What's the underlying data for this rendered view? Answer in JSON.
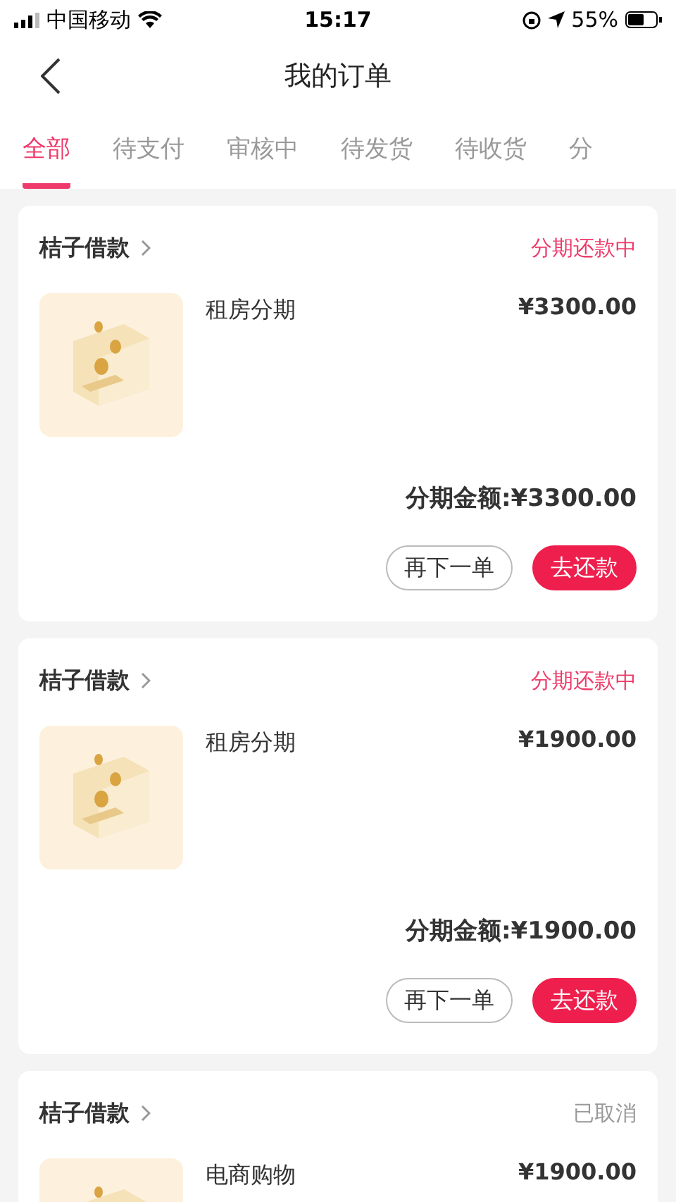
{
  "status_bar": {
    "carrier": "中国移动",
    "time": "15:17",
    "battery": "55%"
  },
  "nav": {
    "title": "我的订单"
  },
  "tabs": [
    {
      "label": "全部",
      "selected": true
    },
    {
      "label": "待支付",
      "selected": false
    },
    {
      "label": "审核中",
      "selected": false
    },
    {
      "label": "待发货",
      "selected": false
    },
    {
      "label": "待收货",
      "selected": false
    },
    {
      "label": "分",
      "selected": false
    }
  ],
  "orders": [
    {
      "merchant": "桔子借款",
      "status": {
        "text": "分期还款中",
        "kind": "active"
      },
      "product": "租房分期",
      "price": "¥3300.00",
      "total": "分期金额:¥3300.00",
      "buttons": [
        {
          "label": "再下一单",
          "kind": "outline"
        },
        {
          "label": "去还款",
          "kind": "primary"
        }
      ]
    },
    {
      "merchant": "桔子借款",
      "status": {
        "text": "分期还款中",
        "kind": "active"
      },
      "product": "租房分期",
      "price": "¥1900.00",
      "total": "分期金额:¥1900.00",
      "buttons": [
        {
          "label": "再下一单",
          "kind": "outline"
        },
        {
          "label": "去还款",
          "kind": "primary"
        }
      ]
    },
    {
      "merchant": "桔子借款",
      "status": {
        "text": "已取消",
        "kind": "cancelled"
      },
      "product": "电商购物",
      "price": "¥1900.00"
    }
  ]
}
